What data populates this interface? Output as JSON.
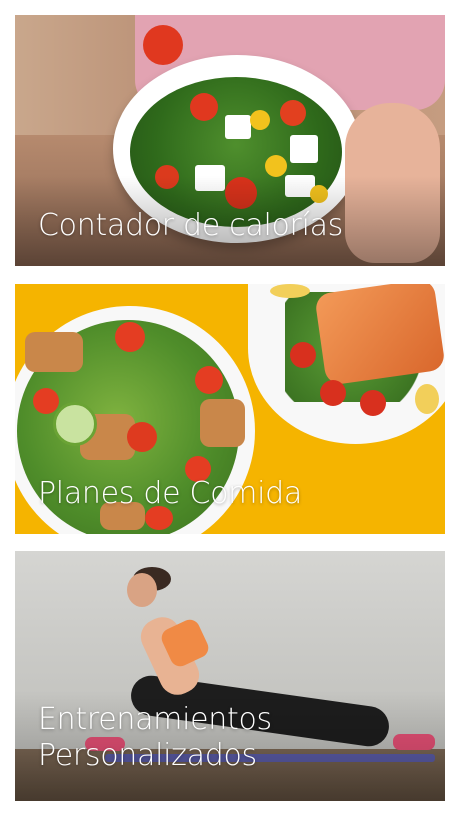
{
  "cards": [
    {
      "title": "Contador de calorías",
      "image": "salad-bowl-image"
    },
    {
      "title": "Planes de Comida",
      "image": "meal-plates-image"
    },
    {
      "title_line1": "Entrenamientos",
      "title_line2": "Personalizados",
      "image": "workout-woman-image"
    }
  ]
}
